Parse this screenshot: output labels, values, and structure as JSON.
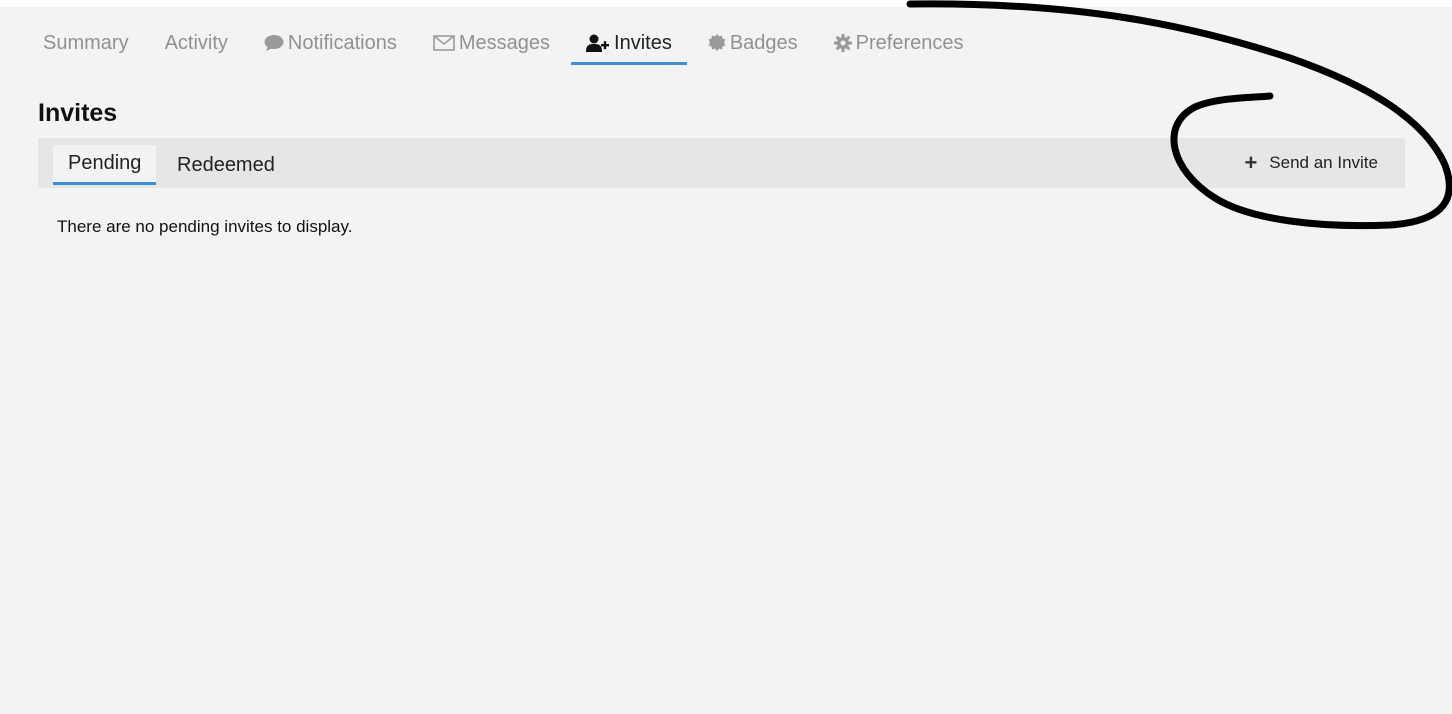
{
  "nav": {
    "items": [
      {
        "label": "Summary",
        "icon": null
      },
      {
        "label": "Activity",
        "icon": null
      },
      {
        "label": "Notifications",
        "icon": "speech-bubble-icon"
      },
      {
        "label": "Messages",
        "icon": "envelope-icon"
      },
      {
        "label": "Invites",
        "icon": "user-plus-icon",
        "active": true
      },
      {
        "label": "Badges",
        "icon": "badge-seal-icon"
      },
      {
        "label": "Preferences",
        "icon": "gear-icon"
      }
    ]
  },
  "page": {
    "title": "Invites",
    "tabs": [
      {
        "label": "Pending",
        "active": true
      },
      {
        "label": "Redeemed",
        "active": false
      }
    ],
    "send_invite_label": "Send an Invite",
    "empty_message": "There are no pending invites to display."
  },
  "colors": {
    "accent": "#3d8fd4",
    "background": "#f3f3f3",
    "subbar": "#e6e6e6",
    "inactive_text": "#919191"
  }
}
